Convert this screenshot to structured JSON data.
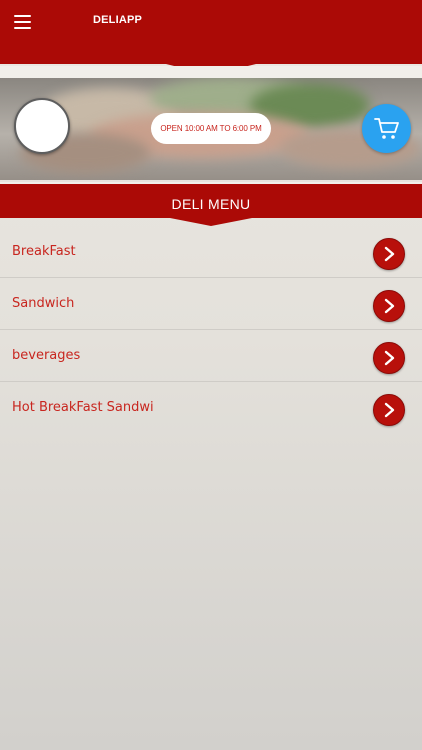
{
  "app": {
    "title": "DELIAPP"
  },
  "header": {
    "menu_icon": "hamburger-menu-icon"
  },
  "hero": {
    "hours_text": "OPEN 10:00 AM TO 6:00 PM",
    "cart_icon": "shopping-cart-icon"
  },
  "section": {
    "title": "DELI MENU"
  },
  "menu": {
    "items": [
      {
        "label": "BreakFast",
        "icon": "chevron-right-icon"
      },
      {
        "label": "Sandwich",
        "icon": "chevron-right-icon"
      },
      {
        "label": "beverages",
        "icon": "chevron-right-icon"
      },
      {
        "label": "Hot BreakFast Sandwi",
        "icon": "chevron-right-icon"
      }
    ]
  },
  "colors": {
    "brand_red": "#ab0a06",
    "label_red": "#c8261f",
    "cart_blue": "#2aa2f0"
  }
}
